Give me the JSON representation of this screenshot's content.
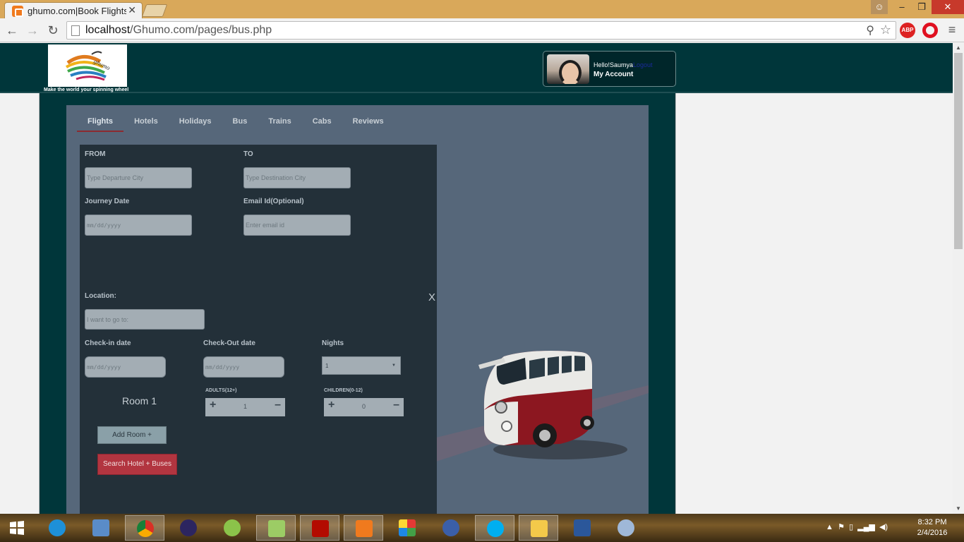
{
  "browser": {
    "tab_title": "ghumo.com|Book Flights,",
    "tab_close": "✕",
    "url_host": "localhost",
    "url_path": "/Ghumo.com/pages/bus.php",
    "abp_label": "ABP",
    "window_buttons": {
      "minimize": "–",
      "maximize": "❐",
      "close": "✕"
    }
  },
  "site": {
    "tagline": "Make the world your spinning wheel",
    "account": {
      "greeting": "Hello!Saumya",
      "logout": "Logout",
      "my_account": "My Account"
    }
  },
  "tabs": [
    "Flights",
    "Hotels",
    "Holidays",
    "Bus",
    "Trains",
    "Cabs",
    "Reviews"
  ],
  "active_tab": "Flights",
  "form": {
    "from_label": "FROM",
    "from_placeholder": "Type Departure City",
    "to_label": "TO",
    "to_placeholder": "Type Destination City",
    "journey_date_label": "Journey Date",
    "journey_date_placeholder": "mm/dd/yyyy",
    "email_label": "Email Id(Optional)",
    "email_placeholder": "Enter email id",
    "close_label": "X",
    "location_label": "Location:",
    "location_placeholder": "I want to go to:",
    "checkin_label": "Check-in date",
    "checkin_placeholder": "mm/dd/yyyy",
    "checkout_label": "Check-Out date",
    "checkout_placeholder": "mm/dd/yyyy",
    "nights_label": "Nights",
    "nights_value": "1",
    "room_title": "Room 1",
    "adults_label": "ADULTS(12+)",
    "adults_value": "1",
    "children_label": "CHILDREN(0-12)",
    "children_value": "0",
    "add_room_label": "Add Room +",
    "search_label": "Search Hotel + Buses"
  },
  "taskbar": {
    "time": "8:32 PM",
    "date": "2/4/2016"
  },
  "colors": {
    "header_bg": "#00363a",
    "panel_bg": "#56677a",
    "form_bg": "#233039",
    "search_button": "#b23540",
    "active_tab_underline": "#8b2b30"
  }
}
